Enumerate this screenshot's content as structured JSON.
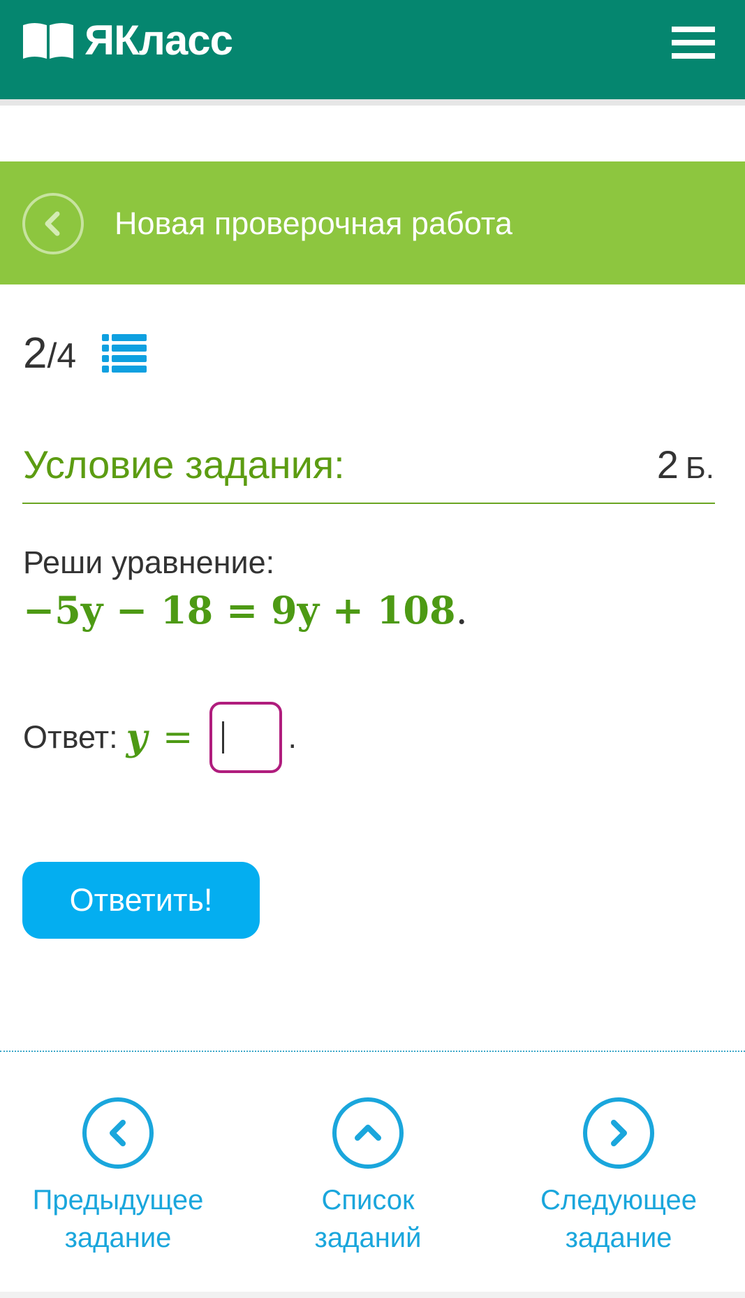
{
  "header": {
    "logo_text": "ЯКласс",
    "book_icon": "book-icon",
    "menu_icon": "hamburger-menu-icon",
    "bg_color": "#05866f"
  },
  "banner": {
    "title": "Новая проверочная работа",
    "back_icon": "chevron-left-icon",
    "bg_color": "#8dc63f"
  },
  "progress": {
    "current": "2",
    "total": "4",
    "list_icon": "list-icon"
  },
  "task": {
    "heading": "Условие задания:",
    "points_value": "2",
    "points_unit": "Б.",
    "instruction": "Реши уравнение:",
    "equation": "−5y − 18 = 9y + 108",
    "equation_end": "."
  },
  "answer": {
    "label": "Ответ:",
    "variable": "y",
    "equals": "=",
    "value": "",
    "end": "."
  },
  "submit_button": {
    "label": "Ответить!",
    "color": "#04aef0"
  },
  "bottom_nav": {
    "prev": {
      "line1": "Предыдущее",
      "line2": "задание",
      "icon": "chevron-left-icon"
    },
    "list": {
      "line1": "Список",
      "line2": "заданий",
      "icon": "chevron-up-icon"
    },
    "next": {
      "line1": "Следующее",
      "line2": "задание",
      "icon": "chevron-right-icon"
    }
  }
}
